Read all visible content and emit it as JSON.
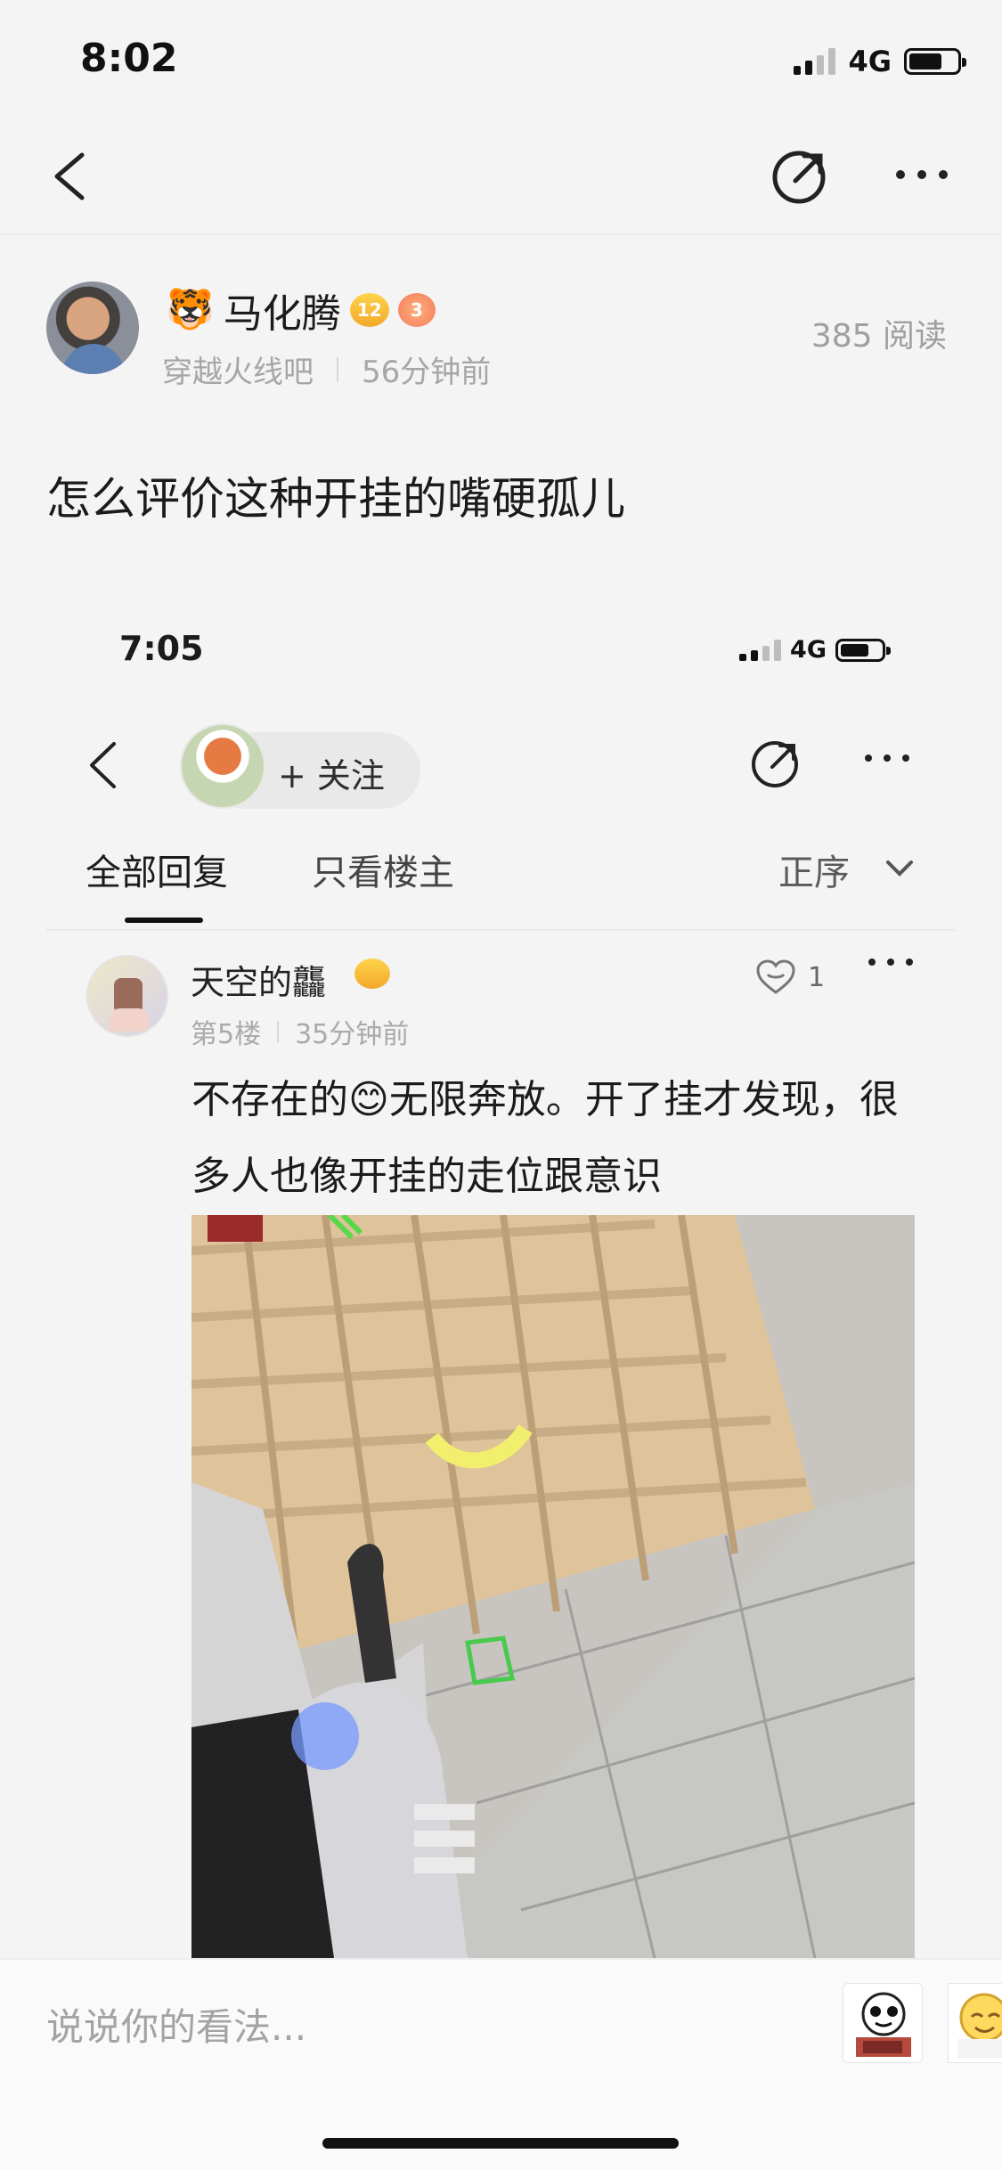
{
  "status_bar": {
    "time": "8:02",
    "network": "4G"
  },
  "navigation": {
    "back_icon": "chevron-left-icon",
    "share_icon": "share-icon",
    "more_icon": "more-icon"
  },
  "post": {
    "author_emoji": "🐯",
    "author_name": "马化腾",
    "level_badge": "12",
    "fire_badge": "3",
    "forum": "穿越火线吧",
    "time_ago": "56分钟前",
    "read_count": "385 阅读",
    "title": "怎么评价这种开挂的嘴硬孤儿"
  },
  "embedded_screenshot": {
    "status_time": "7:05",
    "network": "4G",
    "follow_label": "+ 关注",
    "tabs": {
      "all_replies": "全部回复",
      "owner_only": "只看楼主",
      "sort_order": "正序"
    },
    "reply": {
      "author": "天空的龘",
      "floor": "第5楼",
      "time_ago": "35分钟前",
      "likes": "1",
      "text_part1": "不存在的",
      "emoji": "😊",
      "text_part2": "无限奔放。开了挂才发现，很多人也像开挂的走位跟意识"
    }
  },
  "comment_bar": {
    "placeholder": "说说你的看法..."
  },
  "colors": {
    "background": "#f4f4f4",
    "text": "#1b1b1b",
    "secondary_text": "#a6a6a6",
    "badge_gold": "#f3a82b"
  }
}
